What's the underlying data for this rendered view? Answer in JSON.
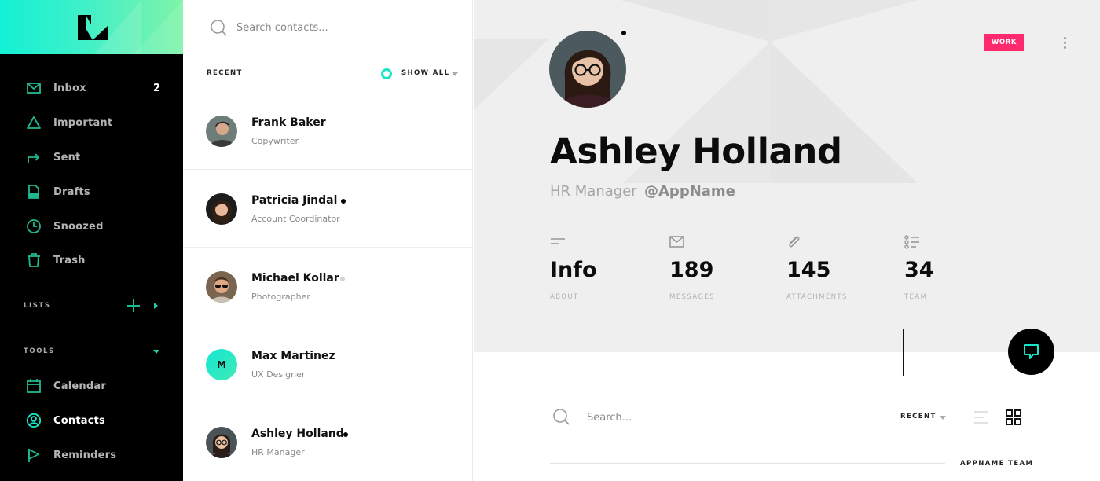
{
  "sidebar": {
    "nav": [
      {
        "label": "Inbox",
        "count": "2",
        "icon": "inbox-icon"
      },
      {
        "label": "Important",
        "icon": "triangle-icon"
      },
      {
        "label": "Sent",
        "icon": "forward-arrow-icon"
      },
      {
        "label": "Drafts",
        "icon": "document-icon"
      },
      {
        "label": "Snoozed",
        "icon": "clock-icon"
      },
      {
        "label": "Trash",
        "icon": "trash-icon"
      }
    ],
    "lists_label": "LISTS",
    "tools_label": "TOOLS",
    "tools": [
      {
        "label": "Calendar",
        "icon": "calendar-icon"
      },
      {
        "label": "Contacts",
        "icon": "contact-icon",
        "active": true
      },
      {
        "label": "Reminders",
        "icon": "flag-icon"
      }
    ]
  },
  "contacts": {
    "search_placeholder": "Search contacts...",
    "recent_label": "RECENT",
    "show_all_label": "SHOW ALL",
    "items": [
      {
        "name": "Frank Baker",
        "role": "Copywriter",
        "status": "none"
      },
      {
        "name": "Patricia Jindal",
        "role": "Account Coordinator",
        "status": "online"
      },
      {
        "name": "Michael Kollar",
        "role": "Photographer",
        "status": "away"
      },
      {
        "name": "Max Martinez",
        "role": "UX Designer",
        "status": "none",
        "initial": "M"
      },
      {
        "name": "Ashley Holland",
        "role": "HR Manager",
        "status": "online"
      }
    ]
  },
  "profile": {
    "name": "Ashley Holland",
    "role": "HR Manager",
    "handle": "@AppName",
    "badge": "WORK",
    "stats": [
      {
        "value": "Info",
        "label": "ABOUT",
        "icon": "lines-icon"
      },
      {
        "value": "189",
        "label": "MESSAGES",
        "icon": "mail-icon"
      },
      {
        "value": "145",
        "label": "ATTACHMENTS",
        "icon": "paperclip-icon"
      },
      {
        "value": "34",
        "label": "TEAM",
        "icon": "list-icon"
      }
    ]
  },
  "team_panel": {
    "search_placeholder": "Search...",
    "sort_label": "RECENT",
    "section_label": "APPNAME TEAM"
  },
  "colors": {
    "accent": "#17e6c7",
    "badge": "#ff2a6d",
    "sidebar_bg": "#000000",
    "icon_green": "#1fb990"
  }
}
